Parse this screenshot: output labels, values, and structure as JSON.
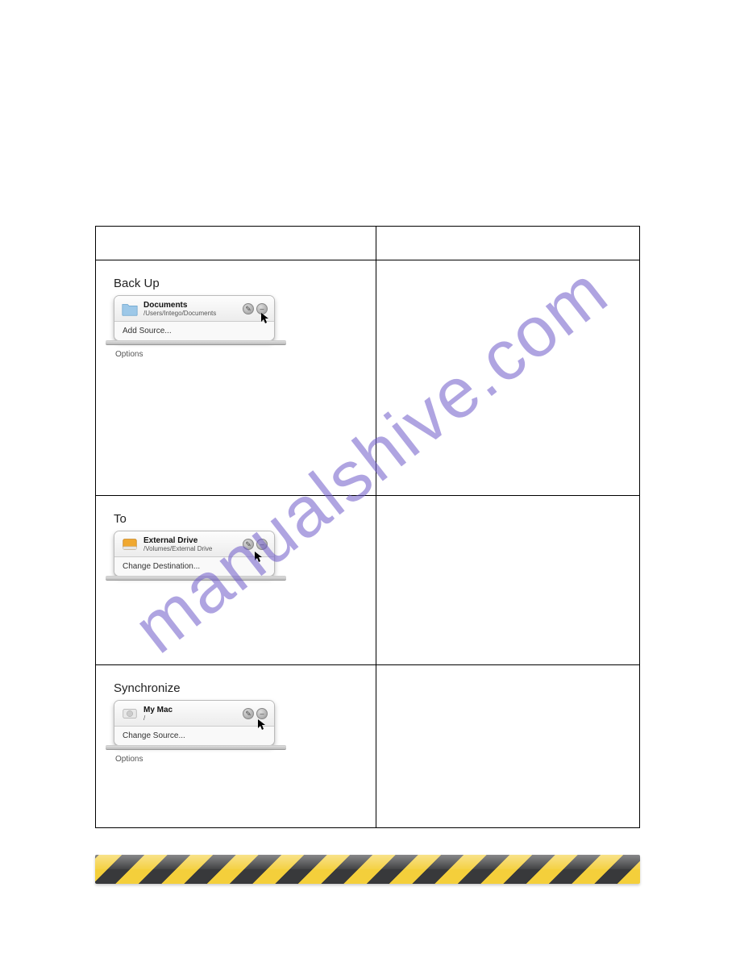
{
  "watermark": "manualshive.com",
  "rows": {
    "backup": {
      "title": "Back Up",
      "item_name": "Documents",
      "item_path": "/Users/Intego/Documents",
      "action": "Add Source...",
      "options": "Options"
    },
    "to": {
      "title": "To",
      "item_name": "External Drive",
      "item_path": "/Volumes/External Drive",
      "action": "Change Destination..."
    },
    "sync": {
      "title": "Synchronize",
      "item_name": "My Mac",
      "item_path": "/",
      "action": "Change Source...",
      "options": "Options"
    }
  }
}
